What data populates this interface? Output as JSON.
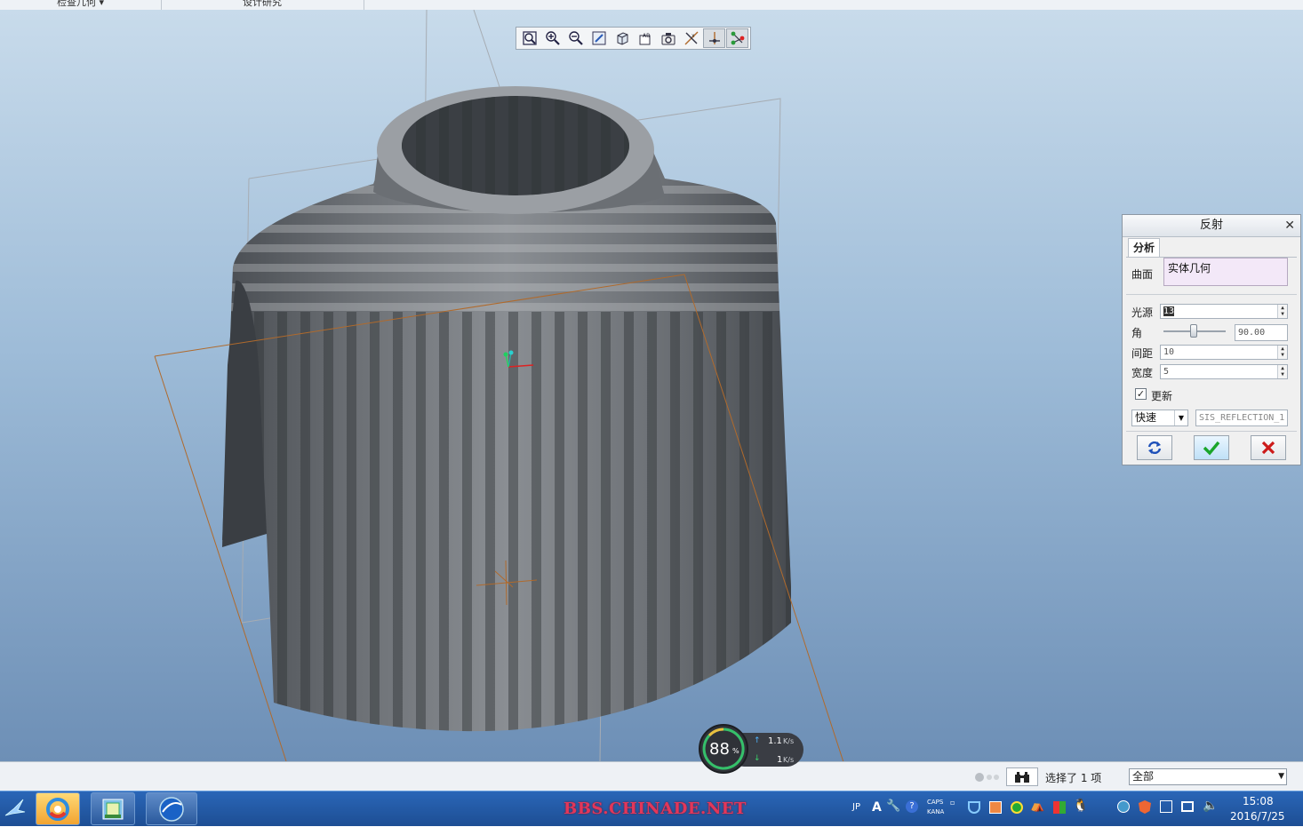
{
  "ribbon": {
    "tabs": [
      "检查几何 ▾",
      "设计研究"
    ]
  },
  "view_toolbar": {
    "icons": [
      "refit-icon",
      "zoom-in-icon",
      "zoom-out-icon",
      "repaint-icon",
      "display-style-icon",
      "saved-views-icon",
      "view-manager-icon",
      "datum-display-icon",
      "spin-center-icon",
      "annotation-display-icon"
    ]
  },
  "dialog": {
    "title": "反射",
    "tab": "分析",
    "surface_label": "曲面",
    "surface_value": "实体几何",
    "light_label": "光源",
    "light_value": "13",
    "angle_label": "角",
    "angle_value": "90.00",
    "spacing_label": "间距",
    "spacing_value": "10",
    "width_label": "宽度",
    "width_value": "5",
    "update_label": "更新",
    "update_checked": true,
    "mode_value": "快速",
    "name_value": "SIS_REFLECTION_1"
  },
  "status": {
    "selection_text": "选择了 1 项",
    "filter_value": "全部"
  },
  "netspeed": {
    "percent": "88",
    "unit": "%",
    "up": "1.1",
    "up_unit": "K/s",
    "down": "1",
    "down_unit": "K/s"
  },
  "taskbar": {
    "watermark": "BBS.CHINADE.NET",
    "tray_lang": "JP",
    "caps": "CAPS",
    "kana": "KANA",
    "time": "15:08",
    "date": "2016/7/25"
  },
  "colors": {
    "viewport_top": "#c8dbeb",
    "viewport_bottom": "#6d8fb6",
    "model_dark": "#3e4247",
    "model_light": "#9a9ea3",
    "datum_orange": "#b06a2c",
    "taskbar": "#1d4e94"
  }
}
